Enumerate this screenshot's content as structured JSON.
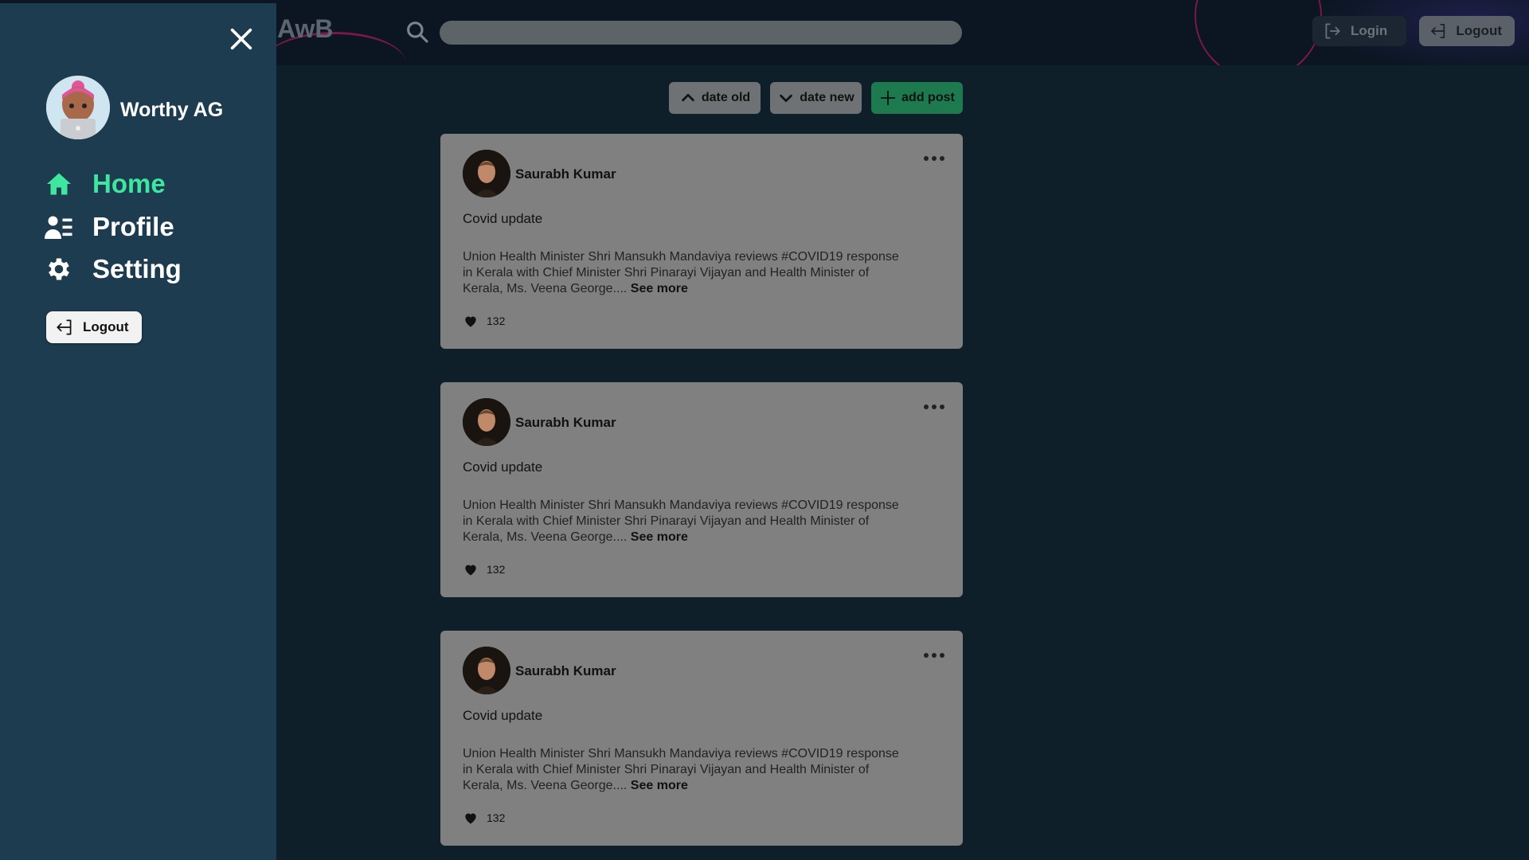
{
  "header": {
    "brand": "AwB",
    "search_placeholder": "",
    "login_label": "Login",
    "logout_label": "Logout"
  },
  "sidebar": {
    "user_name": "Worthy AG",
    "items": [
      {
        "label": "Home",
        "icon": "home-icon",
        "active": true
      },
      {
        "label": "Profile",
        "icon": "profile-icon",
        "active": false
      },
      {
        "label": "Setting",
        "icon": "gear-icon",
        "active": false
      }
    ],
    "logout_label": "Logout"
  },
  "toolbar": {
    "date_old_label": "date old",
    "date_new_label": "date new",
    "add_post_label": "add post"
  },
  "posts": [
    {
      "author": "Saurabh Kumar",
      "title": "Covid update",
      "body": "Union Health Minister Shri Mansukh Mandaviya reviews #COVID19 response in Kerala with Chief Minister Shri Pinarayi Vijayan and Health Minister of Kerala, Ms. Veena George....",
      "see_more": "See more",
      "likes": "132"
    },
    {
      "author": "Saurabh Kumar",
      "title": "Covid update",
      "body": "Union Health Minister Shri Mansukh Mandaviya reviews #COVID19 response in Kerala with Chief Minister Shri Pinarayi Vijayan and Health Minister of Kerala, Ms. Veena George....",
      "see_more": "See more",
      "likes": "132"
    },
    {
      "author": "Saurabh Kumar",
      "title": "Covid update",
      "body": "Union Health Minister Shri Mansukh Mandaviya reviews #COVID19 response in Kerala with Chief Minister Shri Pinarayi Vijayan and Health Minister of Kerala, Ms. Veena George....",
      "see_more": "See more",
      "likes": "132"
    }
  ],
  "colors": {
    "accent_green": "#3ee6a0",
    "sidebar_bg": "#1e3c50",
    "page_bg": "#0f1f2a",
    "card_bg": "#808080",
    "add_post_bg": "#1d7a4f"
  }
}
